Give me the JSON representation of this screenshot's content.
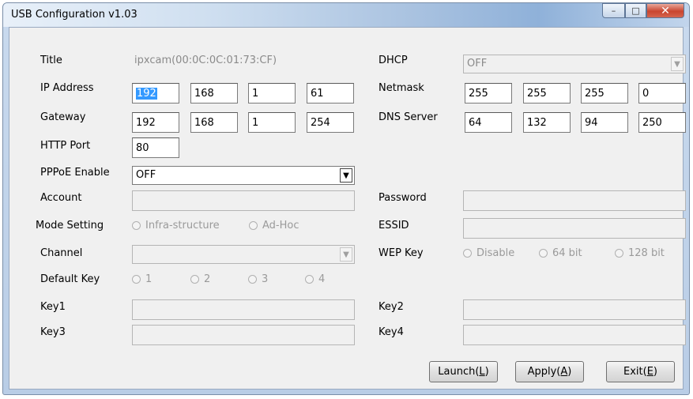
{
  "window": {
    "title": "USB Configuration v1.03"
  },
  "left": {
    "title_label": "Title",
    "title_value": "ipxcam(00:0C:0C:01:73:CF)",
    "ip_label": "IP Address",
    "ip": [
      "192",
      "168",
      "1",
      "61"
    ],
    "gateway_label": "Gateway",
    "gateway": [
      "192",
      "168",
      "1",
      "254"
    ],
    "http_label": "HTTP Port",
    "http_port": "80",
    "pppoe_label": "PPPoE Enable",
    "pppoe_value": "OFF",
    "account_label": "Account",
    "mode_label": "Mode Setting",
    "mode_options": [
      "Infra-structure",
      "Ad-Hoc"
    ],
    "channel_label": "Channel",
    "default_key_label": "Default Key",
    "default_key_options": [
      "1",
      "2",
      "3",
      "4"
    ],
    "key1_label": "Key1",
    "key3_label": "Key3"
  },
  "right": {
    "dhcp_label": "DHCP",
    "dhcp_value": "OFF",
    "netmask_label": "Netmask",
    "netmask": [
      "255",
      "255",
      "255",
      "0"
    ],
    "dns_label": "DNS Server",
    "dns": [
      "64",
      "132",
      "94",
      "250"
    ],
    "password_label": "Password",
    "essid_label": "ESSID",
    "wep_label": "WEP Key",
    "wep_options": [
      "Disable",
      "64 bit",
      "128 bit"
    ],
    "key2_label": "Key2",
    "key4_label": "Key4"
  },
  "buttons": {
    "launch_pre": "Launch(",
    "launch_key": "L",
    "launch_post": ")",
    "apply_pre": "Apply(",
    "apply_key": "A",
    "apply_post": ")",
    "exit_pre": "Exit(",
    "exit_key": "E",
    "exit_post": ")"
  },
  "icons": {
    "minimize": "minimize-icon",
    "maximize": "maximize-icon",
    "close": "close-icon",
    "dropdown": "chevron-down-icon"
  }
}
